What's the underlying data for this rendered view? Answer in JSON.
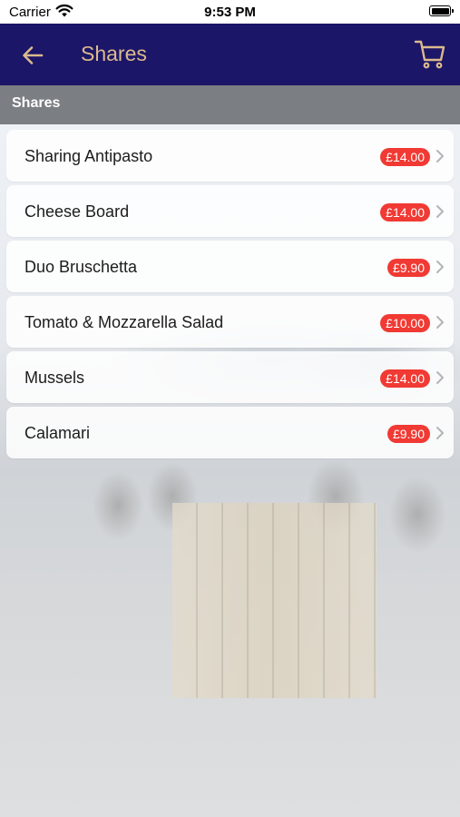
{
  "status_bar": {
    "carrier": "Carrier",
    "time": "9:53 PM"
  },
  "nav": {
    "title": "Shares",
    "back_icon": "arrow-left-icon",
    "cart_icon": "shopping-cart-icon",
    "background": "#1b1668",
    "accent": "#dcb98d"
  },
  "section": {
    "title": "Shares"
  },
  "items": [
    {
      "name": "Sharing Antipasto",
      "price": "£14.00"
    },
    {
      "name": "Cheese Board",
      "price": "£14.00"
    },
    {
      "name": "Duo Bruschetta",
      "price": "£9.90"
    },
    {
      "name": "Tomato & Mozzarella Salad",
      "price": "£10.00"
    },
    {
      "name": "Mussels",
      "price": "£14.00"
    },
    {
      "name": "Calamari",
      "price": "£9.90"
    }
  ],
  "colors": {
    "price_badge": "#f03a33",
    "section_header": "#7b7e82"
  }
}
